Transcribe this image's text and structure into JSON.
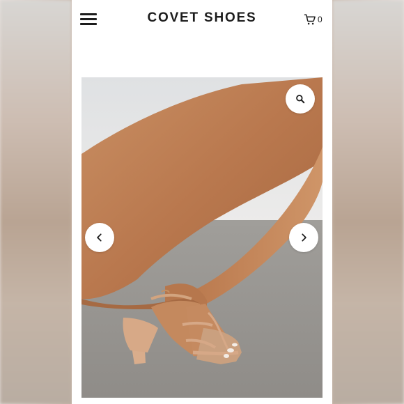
{
  "header": {
    "brand": "COVET SHOES",
    "cart_count": "0"
  },
  "icons": {
    "menu": "hamburger-menu-icon",
    "cart": "shopping-cart-icon",
    "zoom": "zoom-magnifier-icon",
    "prev": "chevron-left-icon",
    "next": "chevron-right-icon"
  },
  "gallery": {
    "image": "product-photo-nude-strappy-block-heel-sandal"
  }
}
